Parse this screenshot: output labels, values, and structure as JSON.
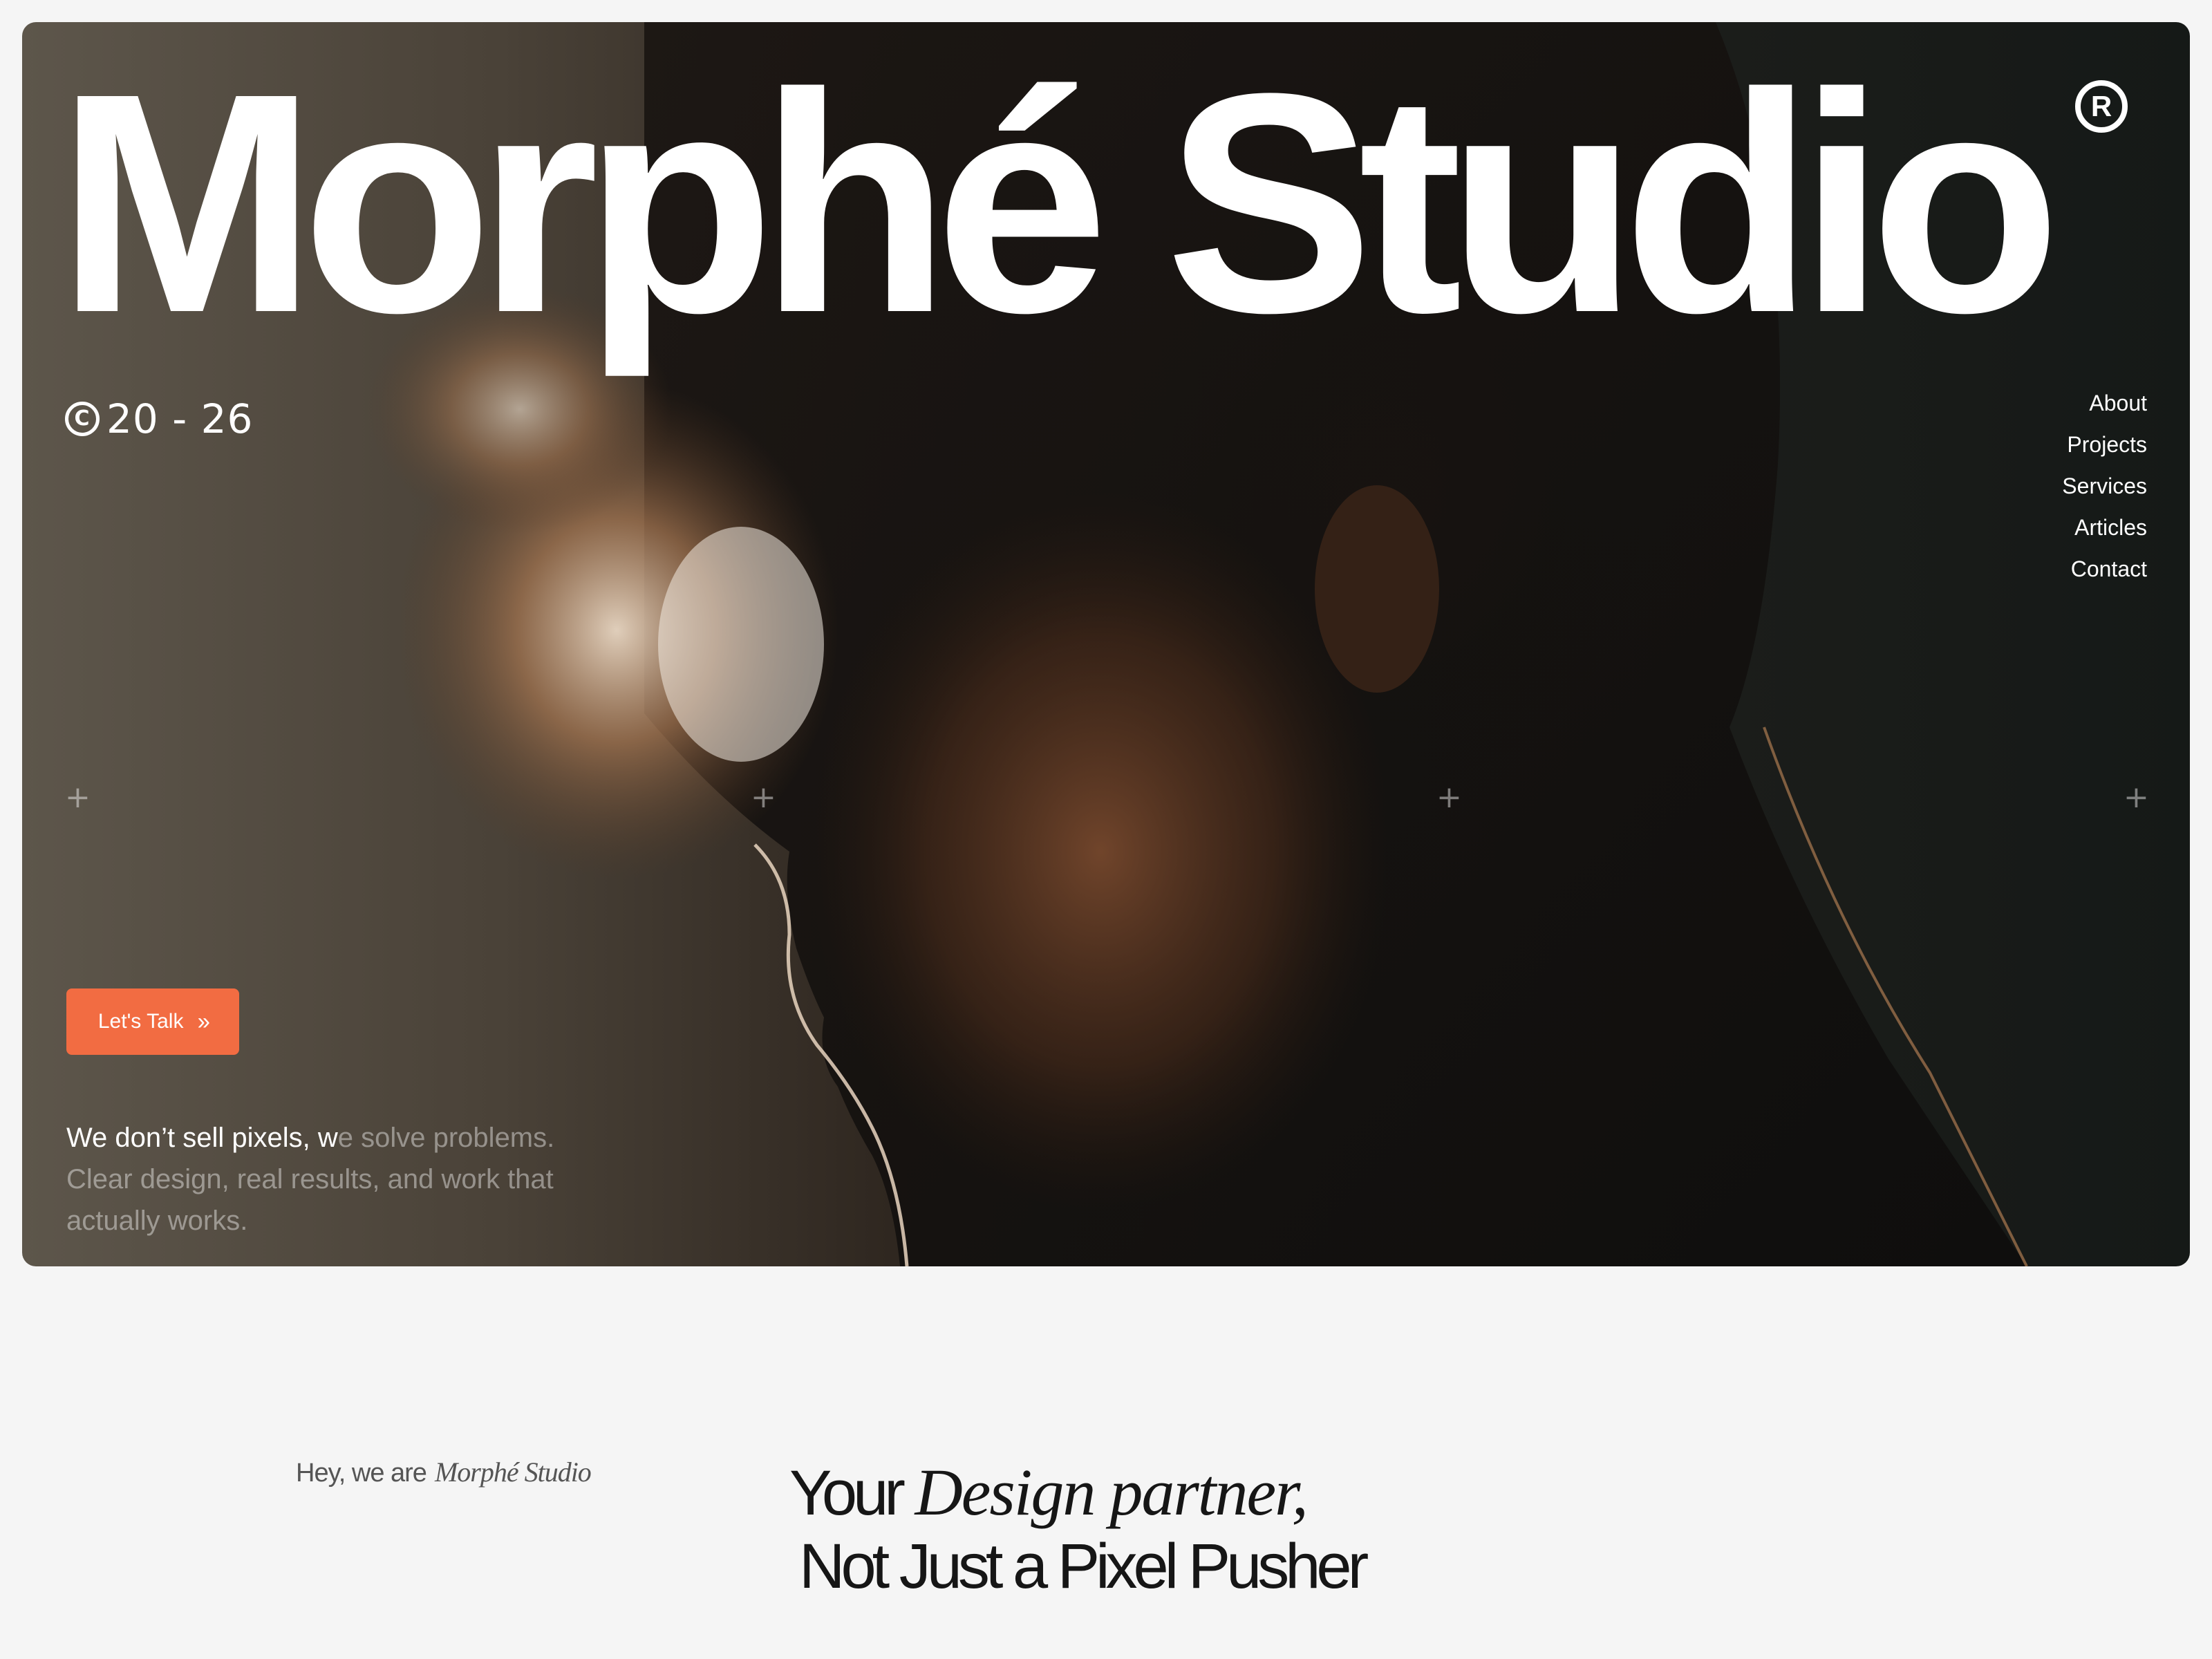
{
  "brand": {
    "title": "Morphé Studio",
    "registered_mark": "R",
    "years": "20 - 26",
    "copyright_glyph": "C"
  },
  "nav": {
    "items": [
      {
        "label": "About"
      },
      {
        "label": "Projects"
      },
      {
        "label": "Services"
      },
      {
        "label": "Articles"
      },
      {
        "label": "Contact"
      }
    ]
  },
  "hero": {
    "cta_label": "Let's Talk",
    "cta_icon": "double-chevron-right-icon",
    "tagline_highlight": "We don’t sell pixels, w",
    "tagline_rest": "e solve problems. Clear design, real results, and work that actually works."
  },
  "intro": {
    "prefix": "Hey, we are",
    "brand": "Morphé Studio",
    "headline_part1": "Your",
    "headline_italic": "Design partner,",
    "headline_line2": "Not Just a Pixel Pusher"
  },
  "colors": {
    "accent": "#f26c42",
    "page_background": "#f5f5f5",
    "hero_text": "#ffffff",
    "headline_text": "#161616"
  }
}
